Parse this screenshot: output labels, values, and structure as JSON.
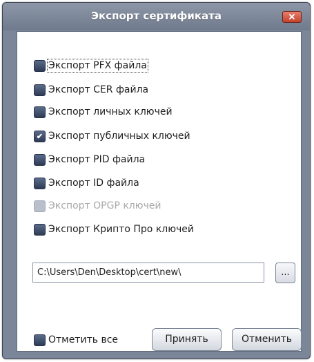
{
  "window": {
    "title": "Экспорт сертификата",
    "close_glyph": "✕"
  },
  "options": [
    {
      "label": "Экспорт PFX файла",
      "checked": false,
      "enabled": true,
      "focused": true
    },
    {
      "label": "Экспорт CER файла",
      "checked": false,
      "enabled": true,
      "focused": false
    },
    {
      "label": "Экспорт личных ключей",
      "checked": false,
      "enabled": true,
      "focused": false
    },
    {
      "label": "Экспорт публичных ключей",
      "checked": true,
      "enabled": true,
      "focused": false
    },
    {
      "label": "Экспорт PID файла",
      "checked": false,
      "enabled": true,
      "focused": false
    },
    {
      "label": "Экспорт ID файла",
      "checked": false,
      "enabled": true,
      "focused": false
    },
    {
      "label": "Экспорт OPGP ключей",
      "checked": false,
      "enabled": false,
      "focused": false
    },
    {
      "label": "Экспорт Крипто Про ключей",
      "checked": false,
      "enabled": true,
      "focused": false
    }
  ],
  "path": {
    "value": "C:\\Users\\Den\\Desktop\\cert\\new\\",
    "browse_label": "..."
  },
  "footer": {
    "select_all_label": "Отметить все",
    "select_all_checked": false,
    "ok_label": "Принять",
    "cancel_label": "Отменить"
  },
  "colors": {
    "titlebar": "#7b8698",
    "checkbox": "#2d3b55",
    "close": "#c4412c"
  }
}
